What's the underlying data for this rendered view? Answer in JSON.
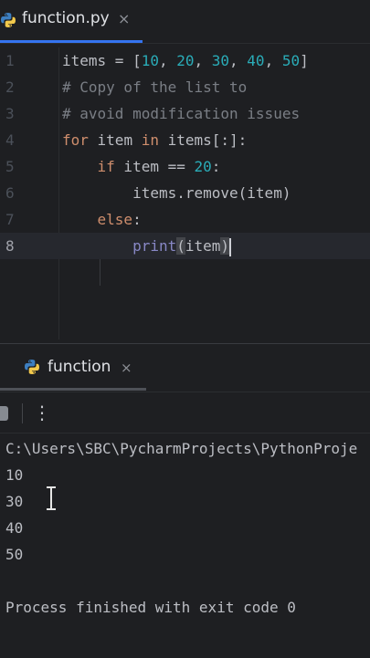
{
  "editor_tab": {
    "title": "function.py",
    "close": "×"
  },
  "editor": {
    "line_numbers": [
      "1",
      "2",
      "3",
      "4",
      "5",
      "6",
      "7",
      "8"
    ],
    "l1": {
      "a": "items = [",
      "n1": "10",
      "c1": ", ",
      "n2": "20",
      "c2": ", ",
      "n3": "30",
      "c3": ", ",
      "n4": "40",
      "c4": ", ",
      "n5": "50",
      "b": "]"
    },
    "l2": "# Copy of the list to",
    "l3": "# avoid modification issues",
    "l4": {
      "kw1": "for",
      "t1": " item ",
      "kw2": "in",
      "t2": " items[:]:"
    },
    "l5": {
      "indent": "    ",
      "kw": "if",
      "t1": " item == ",
      "n": "20",
      "t2": ":"
    },
    "l6": {
      "indent": "        ",
      "t": "items.remove(item)"
    },
    "l7": {
      "indent": "    ",
      "kw": "else",
      "t": ":"
    },
    "l8": {
      "indent": "        ",
      "fn": "print",
      "open": "(",
      "arg": "item",
      "close": ")"
    }
  },
  "run_tab": {
    "title": "function",
    "close": "×"
  },
  "toolbar": {
    "more": "⋮"
  },
  "console": {
    "lines": [
      "C:\\Users\\SBC\\PycharmProjects\\PythonProje",
      "10",
      "30",
      "40",
      "50",
      "",
      "Process finished with exit code 0"
    ]
  },
  "colors": {
    "background": "#1e1f22",
    "keyword": "#cf8e6d",
    "number": "#2aacb8",
    "comment": "#7a7e85",
    "builtin": "#8888c6",
    "accent": "#3574f0"
  },
  "icons": {
    "file_icon": "python-icon",
    "run_icon": "python-icon",
    "stop": "stop-icon",
    "more": "more-vertical-icon"
  }
}
